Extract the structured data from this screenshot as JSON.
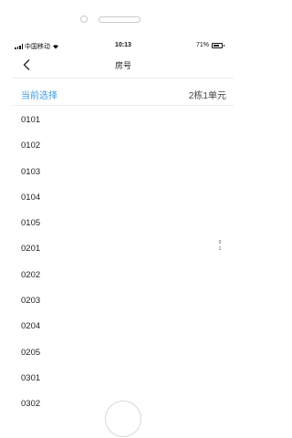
{
  "status_bar": {
    "carrier": "中国移动",
    "time": "10:13",
    "battery_percent": "71%",
    "battery_level": 0.71
  },
  "nav": {
    "back_icon": "chevron-left-icon",
    "title": "房号"
  },
  "current_selection": {
    "label": "当前选择",
    "value": "2栋1单元",
    "accent_color": "#3d9bdf"
  },
  "rooms": [
    "0101",
    "0102",
    "0103",
    "0104",
    "0105",
    "0201",
    "0202",
    "0203",
    "0204",
    "0205",
    "0301",
    "0302"
  ],
  "index_bar": [
    "0",
    "1"
  ]
}
